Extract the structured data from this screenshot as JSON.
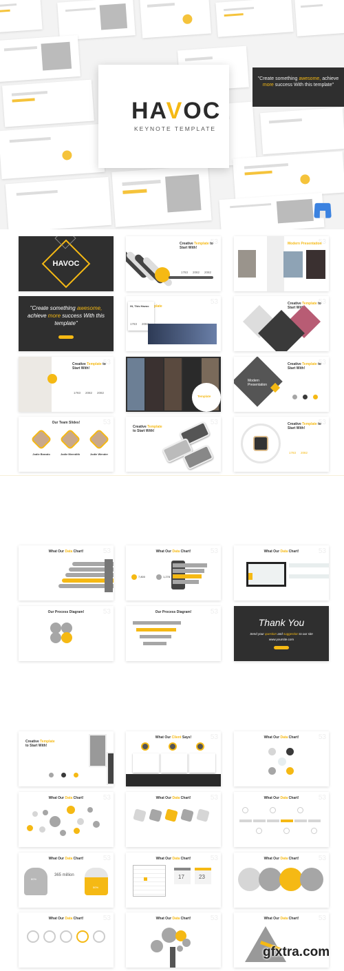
{
  "colors": {
    "accent": "#f5b914",
    "dark": "#2f2f2f",
    "gray": "#a6a6a6"
  },
  "hero": {
    "logo_pre": "HA",
    "logo_accent": "V",
    "logo_post": "OC",
    "subtitle": "KEYNOTE TEMPLATE",
    "quote": {
      "pre": "\"Create something ",
      "hl": "awesome,",
      "mid": " achieve ",
      "hl2": "more",
      "post": " success With this template\""
    },
    "app_icon": "keynote-icon"
  },
  "slides": [
    {
      "kind": "dark-title",
      "title": "HAVOC"
    },
    {
      "kind": "creative",
      "num": "53",
      "title": {
        "pre": "Creative ",
        "hl": "Template",
        "post": " to Start With!"
      },
      "values": [
        "1783",
        "2082",
        "2082"
      ],
      "image": "diagonal-photos"
    },
    {
      "kind": "creative",
      "num": "53",
      "title": {
        "pre": "",
        "hl": "Modern Presentation",
        "post": ""
      },
      "image": "photo-triptych"
    },
    {
      "kind": "quote",
      "text": {
        "pre": "\"Create something ",
        "hl": "awesome,",
        "mid": " achieve ",
        "hl2": "more",
        "post": " success With this template\""
      }
    },
    {
      "kind": "creative",
      "num": "53",
      "title": {
        "pre": "Creative ",
        "hl": "Template",
        "post": " to Start With!"
      },
      "values": [
        "1783",
        "2082"
      ],
      "card": "Hi, This Havoc",
      "image": "photo-bottom"
    },
    {
      "kind": "creative",
      "num": "53",
      "title": {
        "pre": "Creative ",
        "hl": "Template",
        "post": " to Start With!"
      },
      "image": "diamonds"
    },
    {
      "kind": "creative",
      "num": "53",
      "title": {
        "pre": "Creative ",
        "hl": "Template",
        "post": " to Start With!"
      },
      "values": [
        "1783",
        "2082",
        "2082"
      ],
      "image": "photo-left"
    },
    {
      "kind": "creative",
      "title": {
        "pre": "Creative ",
        "hl": "Template",
        "post": " to Start With!"
      },
      "image": "collage"
    },
    {
      "kind": "creative",
      "num": "53",
      "title": {
        "pre": "Creative ",
        "hl": "Template",
        "post": " to Start With!"
      },
      "overlay": "Modern Presentation",
      "image": "diamond-photo"
    },
    {
      "kind": "team",
      "num": "53",
      "title": {
        "pre": "Our Team Slides!",
        "hl": "",
        "post": ""
      },
      "names": [
        "Jodie Brando",
        "Jodie Meredith",
        "Jodie Wender"
      ]
    },
    {
      "kind": "creative",
      "num": "53",
      "title": {
        "pre": "Creative ",
        "hl": "Template",
        "post": " to Start With!"
      },
      "image": "phones"
    },
    {
      "kind": "creative",
      "num": "53",
      "title": {
        "pre": "Creative ",
        "hl": "Template",
        "post": " to Start With!"
      },
      "values": [
        "1783",
        "2082"
      ],
      "image": "watch"
    },
    {
      "kind": "chart",
      "viz": "bars",
      "num": "53",
      "title": {
        "pre": "What Our ",
        "hl": "Data",
        "post": " Chart!"
      }
    },
    {
      "kind": "chart",
      "viz": "phone",
      "num": "53",
      "title": {
        "pre": "What Our ",
        "hl": "Data",
        "post": " Chart!"
      },
      "values": [
        "7,800",
        "1,278"
      ]
    },
    {
      "kind": "chart",
      "viz": "laptop",
      "num": "53",
      "title": {
        "pre": "What Our ",
        "hl": "Data",
        "post": " Chart!"
      }
    },
    {
      "kind": "chart",
      "viz": "flower",
      "num": "53",
      "title": {
        "pre": "Our Process Diagram!",
        "hl": "",
        "post": ""
      }
    },
    {
      "kind": "chart",
      "viz": "arrows",
      "num": "53",
      "title": {
        "pre": "Our Process Diagram!",
        "hl": "",
        "post": ""
      }
    },
    {
      "kind": "thanks",
      "title": "Thank You",
      "text": {
        "pre": "Send your ",
        "hl": "question",
        "mid": " and ",
        "hl2": "suggestion",
        "post": " to our site"
      },
      "url": "www.yoursite.com"
    },
    {
      "kind": "creative",
      "title": {
        "pre": "Creative ",
        "hl": "Template",
        "post": " to Start With!"
      },
      "image": "phone-photos"
    },
    {
      "kind": "chart",
      "viz": "client",
      "num": "53",
      "title": {
        "pre": "What Our ",
        "hl": "Client",
        "post": " Says!"
      }
    },
    {
      "kind": "chart",
      "viz": "icons4",
      "num": "53",
      "title": {
        "pre": "What Our ",
        "hl": "Data",
        "post": " Chart!"
      }
    },
    {
      "kind": "chart",
      "viz": "bubbles",
      "num": "53",
      "title": {
        "pre": "What Our ",
        "hl": "Data",
        "post": " Chart!"
      }
    },
    {
      "kind": "chart",
      "viz": "squares",
      "num": "53",
      "title": {
        "pre": "What Our ",
        "hl": "Data",
        "post": " Chart!"
      }
    },
    {
      "kind": "chart",
      "viz": "timeline",
      "num": "53",
      "title": {
        "pre": "What Our ",
        "hl": "Data",
        "post": " Chart!"
      }
    },
    {
      "kind": "chart",
      "viz": "heads",
      "num": "53",
      "title": {
        "pre": "What Our ",
        "hl": "Data",
        "post": " Chart!"
      },
      "value": "365 million",
      "percents": [
        "80%",
        "50%"
      ]
    },
    {
      "kind": "chart",
      "viz": "calendar",
      "num": "53",
      "title": {
        "pre": "What Our ",
        "hl": "Data",
        "post": " Chart!"
      },
      "dates": [
        "17",
        "23"
      ]
    },
    {
      "kind": "chart",
      "viz": "circles4",
      "num": "53",
      "title": {
        "pre": "What Our ",
        "hl": "Data",
        "post": " Chart!"
      }
    },
    {
      "kind": "chart",
      "viz": "rings",
      "num": "53",
      "title": {
        "pre": "What Our ",
        "hl": "Data",
        "post": " Chart!"
      }
    },
    {
      "kind": "chart",
      "viz": "tree",
      "num": "53",
      "title": {
        "pre": "What Our ",
        "hl": "Data",
        "post": " Chart!"
      }
    },
    {
      "kind": "chart",
      "viz": "pyramid",
      "num": "53",
      "title": {
        "pre": "What Our ",
        "hl": "Data",
        "post": " Chart!"
      }
    }
  ],
  "watermark": "gfxtra.com"
}
